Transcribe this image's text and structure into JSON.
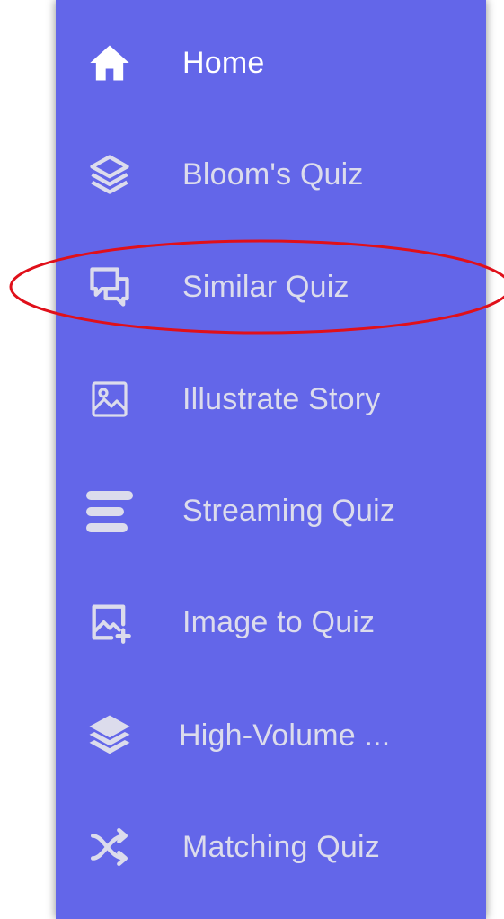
{
  "sidebar": {
    "background_color": "#6366e9",
    "text_color": "#dcdcec",
    "active_text_color": "#ffffff",
    "items": [
      {
        "label": "Home",
        "icon": "home-icon",
        "active": true
      },
      {
        "label": "Bloom's Quiz",
        "icon": "layers-outline-icon",
        "active": false
      },
      {
        "label": "Similar Quiz",
        "icon": "chat-bubbles-icon",
        "active": false
      },
      {
        "label": "Illustrate Story",
        "icon": "image-icon",
        "active": false
      },
      {
        "label": "Streaming Quiz",
        "icon": "align-left-icon",
        "active": false
      },
      {
        "label": "Image to Quiz",
        "icon": "image-add-icon",
        "active": false
      },
      {
        "label": "High-Volume ...",
        "icon": "layers-filled-icon",
        "active": false
      },
      {
        "label": "Matching Quiz",
        "icon": "shuffle-icon",
        "active": false
      }
    ]
  },
  "annotation": {
    "shape": "ellipse",
    "color": "#e0101a",
    "target": "Similar Quiz"
  }
}
